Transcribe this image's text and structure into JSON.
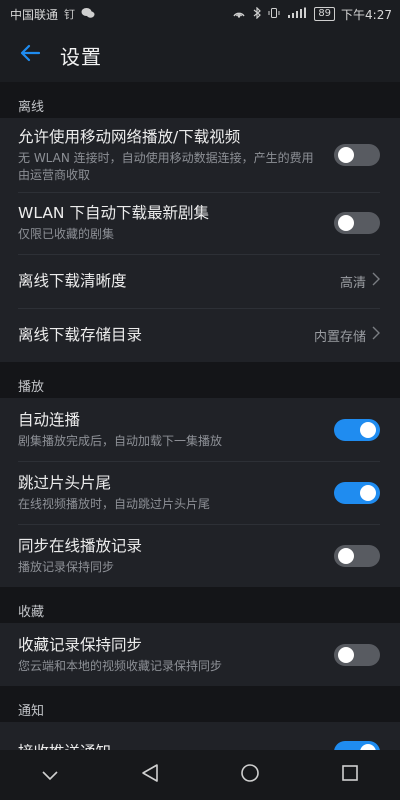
{
  "status_bar": {
    "carrier": "中国联通",
    "carrier_extra": "钉",
    "battery": "89",
    "time": "下午4:27"
  },
  "header": {
    "title": "设置"
  },
  "sections": {
    "offline": {
      "header": "离线",
      "items": [
        {
          "title": "允许使用移动网络播放/下载视频",
          "subtitle": "无 WLAN 连接时，自动使用移动数据连接，产生的费用由运营商收取",
          "toggle": false
        },
        {
          "title": "WLAN 下自动下载最新剧集",
          "subtitle": "仅限已收藏的剧集",
          "toggle": false
        },
        {
          "title": "离线下载清晰度",
          "value": "高清"
        },
        {
          "title": "离线下载存储目录",
          "value": "内置存储"
        }
      ]
    },
    "playback": {
      "header": "播放",
      "items": [
        {
          "title": "自动连播",
          "subtitle": "剧集播放完成后，自动加载下一集播放",
          "toggle": true
        },
        {
          "title": "跳过片头片尾",
          "subtitle": "在线视频播放时，自动跳过片头片尾",
          "toggle": true
        },
        {
          "title": "同步在线播放记录",
          "subtitle": "播放记录保持同步",
          "toggle": false
        }
      ]
    },
    "favorites": {
      "header": "收藏",
      "items": [
        {
          "title": "收藏记录保持同步",
          "subtitle": "您云端和本地的视频收藏记录保持同步",
          "toggle": false
        }
      ]
    },
    "notification": {
      "header": "通知",
      "items": [
        {
          "title": "接收推送通知",
          "toggle": true
        }
      ]
    }
  },
  "colors": {
    "accent": "#1f8cf0",
    "background": "#1b1d21",
    "toggle_off": "#585b61"
  },
  "icons": [
    "back-arrow-icon",
    "chevron-right-icon",
    "nav-collapse-icon",
    "nav-back-icon",
    "nav-home-icon",
    "nav-recents-icon"
  ]
}
